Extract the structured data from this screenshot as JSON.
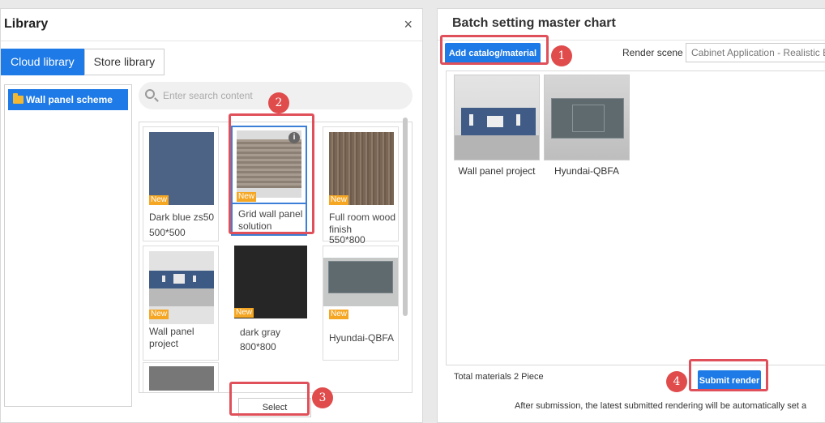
{
  "library": {
    "title": "Library",
    "close": "×",
    "tabs": [
      {
        "label": "Cloud library",
        "active": true
      },
      {
        "label": "Store library",
        "active": false
      }
    ],
    "tree_item": "Wall panel scheme",
    "search_placeholder": "Enter search content",
    "items": [
      {
        "name": "Dark blue zs50",
        "size": "500*500",
        "badge": "New"
      },
      {
        "name": "Grid wall panel solution",
        "size": "",
        "badge": "New"
      },
      {
        "name": "Full room wood finish",
        "size": "550*800",
        "badge": "New"
      },
      {
        "name": "Wall panel project",
        "size": "",
        "badge": "New"
      },
      {
        "name": "dark gray",
        "size": "800*800",
        "badge": "New"
      },
      {
        "name": "Hyundai-QBFA",
        "size": "",
        "badge": "New"
      }
    ],
    "select_label": "Select"
  },
  "batch": {
    "title": "Batch setting master chart",
    "add_label": "Add catalog/material",
    "render_label": "Render scene",
    "render_value": "Cabinet Application - Realistic Ba",
    "materials": [
      {
        "name": "Wall panel project"
      },
      {
        "name": "Hyundai-QBFA"
      }
    ],
    "total": "Total materials 2 Piece",
    "submit_label": "Submit render",
    "note": "After submission, the latest submitted rendering will be automatically set a"
  },
  "steps": [
    "1",
    "2",
    "3",
    "4"
  ],
  "colors": {
    "accent": "#1e7ae6",
    "highlight": "#e0505a",
    "badge": "#f5a623"
  }
}
